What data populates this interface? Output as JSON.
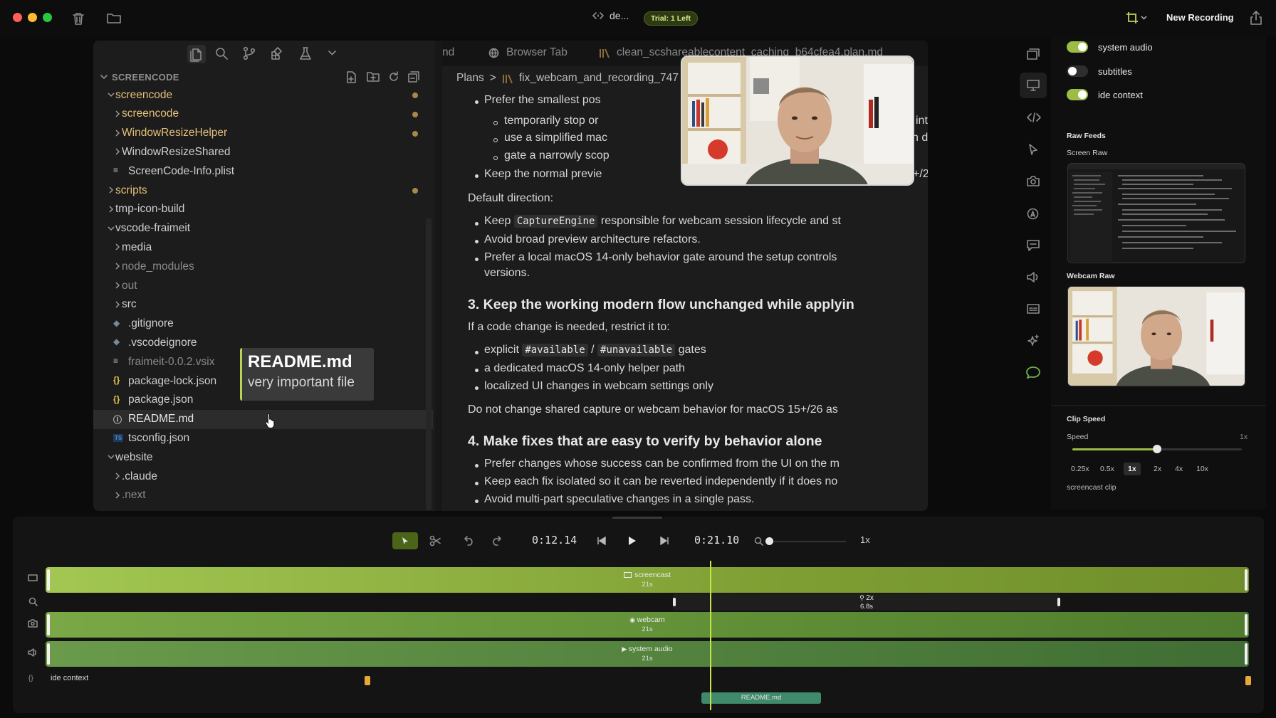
{
  "window": {
    "title": "de...",
    "trial_badge": "Trial: 1 Left",
    "new_recording_label": "New Recording",
    "traffic_colors": [
      "#ff5f57",
      "#febc2e",
      "#28c840"
    ]
  },
  "explorer": {
    "section_title": "SCREENCODE",
    "items": [
      {
        "label": "screencode",
        "depth": 0,
        "kind": "folder-open",
        "color": "#e2c07a",
        "dot": true
      },
      {
        "label": "screencode",
        "depth": 1,
        "kind": "folder",
        "color": "#e2c07a",
        "dot": true
      },
      {
        "label": "WindowResizeHelper",
        "depth": 1,
        "kind": "folder",
        "color": "#e2c07a",
        "dot": true
      },
      {
        "label": "WindowResizeShared",
        "depth": 1,
        "kind": "folder",
        "color": "#cfcfcf",
        "dot": false
      },
      {
        "label": "ScreenCode-Info.plist",
        "depth": 1,
        "kind": "file-lines",
        "color": "#cfcfcf",
        "dot": false
      },
      {
        "label": "scripts",
        "depth": 0,
        "kind": "folder",
        "color": "#e2c07a",
        "dot": true
      },
      {
        "label": "tmp-icon-build",
        "depth": 0,
        "kind": "folder",
        "color": "#cfcfcf",
        "dot": false
      },
      {
        "label": "vscode-fraimeit",
        "depth": 0,
        "kind": "folder-open",
        "color": "#cfcfcf",
        "dot": false
      },
      {
        "label": "media",
        "depth": 1,
        "kind": "folder",
        "color": "#cfcfcf",
        "dot": false
      },
      {
        "label": "node_modules",
        "depth": 1,
        "kind": "folder",
        "color": "#8a8a8a",
        "dot": false
      },
      {
        "label": "out",
        "depth": 1,
        "kind": "folder",
        "color": "#8a8a8a",
        "dot": false
      },
      {
        "label": "src",
        "depth": 1,
        "kind": "folder",
        "color": "#cfcfcf",
        "dot": false
      },
      {
        "label": ".gitignore",
        "depth": 1,
        "kind": "file-diamond",
        "color": "#cfcfcf",
        "dot": false
      },
      {
        "label": ".vscodeignore",
        "depth": 1,
        "kind": "file-diamond",
        "color": "#cfcfcf",
        "dot": false
      },
      {
        "label": "fraimeit-0.0.2.vsix",
        "depth": 1,
        "kind": "file-lines",
        "color": "#8a8a8a",
        "dot": false
      },
      {
        "label": "package-lock.json",
        "depth": 1,
        "kind": "file-json",
        "color": "#cfcfcf",
        "dot": false
      },
      {
        "label": "package.json",
        "depth": 1,
        "kind": "file-json",
        "color": "#cfcfcf",
        "dot": false
      },
      {
        "label": "README.md",
        "depth": 1,
        "kind": "file-info",
        "color": "#e6e6e6",
        "dot": false,
        "selected": true
      },
      {
        "label": "tsconfig.json",
        "depth": 1,
        "kind": "file-ts",
        "color": "#cfcfcf",
        "dot": false
      },
      {
        "label": "website",
        "depth": 0,
        "kind": "folder-open",
        "color": "#cfcfcf",
        "dot": false
      },
      {
        "label": ".claude",
        "depth": 1,
        "kind": "folder",
        "color": "#cfcfcf",
        "dot": false
      },
      {
        "label": ".next",
        "depth": 1,
        "kind": "folder",
        "color": "#8a8a8a",
        "dot": false
      }
    ]
  },
  "tooltip": {
    "title": "README.md",
    "subtitle": "very important file"
  },
  "editor": {
    "tabs": [
      "nd",
      "Browser Tab",
      "clean_scshareablecontent_caching_b64cfea4.plan.md"
    ],
    "breadcrumb": [
      "Plans",
      ">",
      "fix_webcam_and_recording_747"
    ],
    "doc": {
      "b1": "Prefer the smallest pos",
      "s1": "temporarily stop or",
      "s1_tail": "int",
      "s2": "use a simplified mac",
      "s2_tail": "n de",
      "s3": "gate a narrowly scop",
      "b2": "Keep the normal previe",
      "b2_tail": "+/2",
      "p1": "Default direction:",
      "b3_pre": "Keep",
      "b3_code": "CaptureEngine",
      "b3_post": "responsible for webcam session lifecycle and st",
      "b4": "Avoid broad preview architecture refactors.",
      "b5": "Prefer a local macOS 14-only behavior gate around the setup controls",
      "b5_cont": "versions.",
      "h3": "3. Keep the working modern flow unchanged while applyin",
      "p2": "If a code change is needed, restrict it to:",
      "b6_pre": "explicit",
      "b6_code1": "#available",
      "b6_sep": "/",
      "b6_code2": "#unavailable",
      "b6_post": "gates",
      "b7": "a dedicated macOS 14-only helper path",
      "b8": "localized UI changes in webcam settings only",
      "p3": "Do not change shared capture or webcam behavior for macOS 15+/26 as",
      "h4": "4. Make fixes that are easy to verify by behavior alone",
      "b9": "Prefer changes whose success can be confirmed from the UI on the m",
      "b10": "Keep each fix isolated so it can be reverted independently if it does no",
      "b11": "Avoid multi-part speculative changes in a single pass."
    }
  },
  "panel": {
    "toggles": [
      {
        "label": "system audio",
        "on": true
      },
      {
        "label": "subtitles",
        "on": false
      },
      {
        "label": "ide context",
        "on": true
      }
    ],
    "raw_feeds_title": "Raw Feeds",
    "screen_raw_label": "Screen Raw",
    "webcam_raw_label": "Webcam Raw",
    "clip_speed_title": "Clip Speed",
    "speed_label": "Speed",
    "speed_value": "1x",
    "speed_slider_fraction": 0.5,
    "speed_options": [
      "0.25x",
      "0.5x",
      "1x",
      "2x",
      "4x",
      "10x"
    ],
    "speed_selected": "1x",
    "clip_name": "screencast clip"
  },
  "timeline": {
    "current_time": "0:12.14",
    "total_time": "0:21.10",
    "zoom_value": "1x",
    "zoom_fraction": 0.02,
    "playhead_fraction": 0.58,
    "tracks": {
      "screencast": {
        "label": "screencast",
        "duration": "21s"
      },
      "zoom": {
        "label": "2x",
        "duration": "6.8s"
      },
      "webcam": {
        "label": "webcam",
        "duration": "21s"
      },
      "audio": {
        "label": "system audio",
        "duration": "21s"
      },
      "ide": {
        "label": "ide context",
        "clip": "README.md"
      }
    },
    "colors": {
      "accent": "#b8d35a",
      "screencast": "#9cbc45",
      "webcam": "#6f9a3e",
      "audio": "#5e8a44",
      "ide": "#3f8a6a"
    }
  }
}
